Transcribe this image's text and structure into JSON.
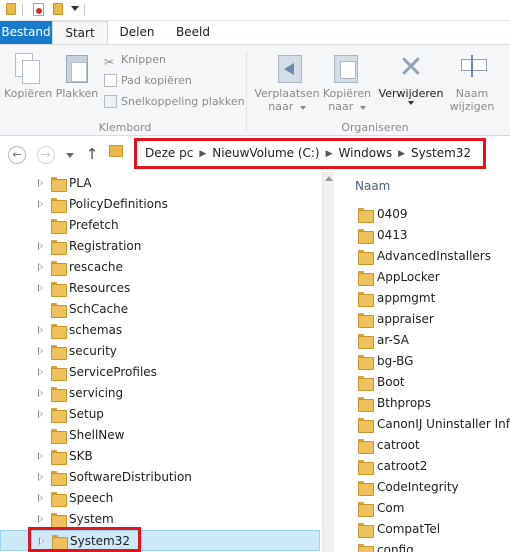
{
  "ribbon": {
    "tabs": [
      "Bestand",
      "Start",
      "Delen",
      "Beeld"
    ],
    "clipboard": {
      "copy": "Kopiëren",
      "paste": "Plakken",
      "cut": "Knippen",
      "copy_path": "Pad kopiëren",
      "paste_shortcut": "Snelkoppeling plakken",
      "group_label": "Klembord"
    },
    "organize": {
      "move_to_line1": "Verplaatsen",
      "move_to_line2": "naar",
      "copy_to_line1": "Kopiëren",
      "copy_to_line2": "naar",
      "delete": "Verwijderen",
      "rename_line1": "Naam",
      "rename_line2": "wijzigen",
      "group_label": "Organiseren"
    }
  },
  "address": {
    "crumbs": [
      "Deze pc",
      "NieuwVolume (C:)",
      "Windows",
      "System32"
    ]
  },
  "tree": {
    "items": [
      {
        "label": "PLA",
        "expandable": true
      },
      {
        "label": "PolicyDefinitions",
        "expandable": true
      },
      {
        "label": "Prefetch",
        "expandable": false
      },
      {
        "label": "Registration",
        "expandable": true
      },
      {
        "label": "rescache",
        "expandable": true
      },
      {
        "label": "Resources",
        "expandable": true
      },
      {
        "label": "SchCache",
        "expandable": false
      },
      {
        "label": "schemas",
        "expandable": true
      },
      {
        "label": "security",
        "expandable": true
      },
      {
        "label": "ServiceProfiles",
        "expandable": true
      },
      {
        "label": "servicing",
        "expandable": true
      },
      {
        "label": "Setup",
        "expandable": true
      },
      {
        "label": "ShellNew",
        "expandable": false
      },
      {
        "label": "SKB",
        "expandable": true
      },
      {
        "label": "SoftwareDistribution",
        "expandable": true
      },
      {
        "label": "Speech",
        "expandable": true
      },
      {
        "label": "System",
        "expandable": true
      },
      {
        "label": "System32",
        "expandable": true,
        "selected": true
      }
    ]
  },
  "files": {
    "column_header": "Naam",
    "items": [
      "0409",
      "0413",
      "AdvancedInstallers",
      "AppLocker",
      "appmgmt",
      "appraiser",
      "ar-SA",
      "bg-BG",
      "Boot",
      "Bthprops",
      "CanonIJ Uninstaller Inform",
      "catroot",
      "catroot2",
      "CodeIntegrity",
      "Com",
      "CompatTel",
      "config"
    ]
  },
  "colors": {
    "file_tab": "#1979ca",
    "highlight_border": "#e0141e",
    "selection": "#cde8f7",
    "folder": "#eec25a"
  }
}
